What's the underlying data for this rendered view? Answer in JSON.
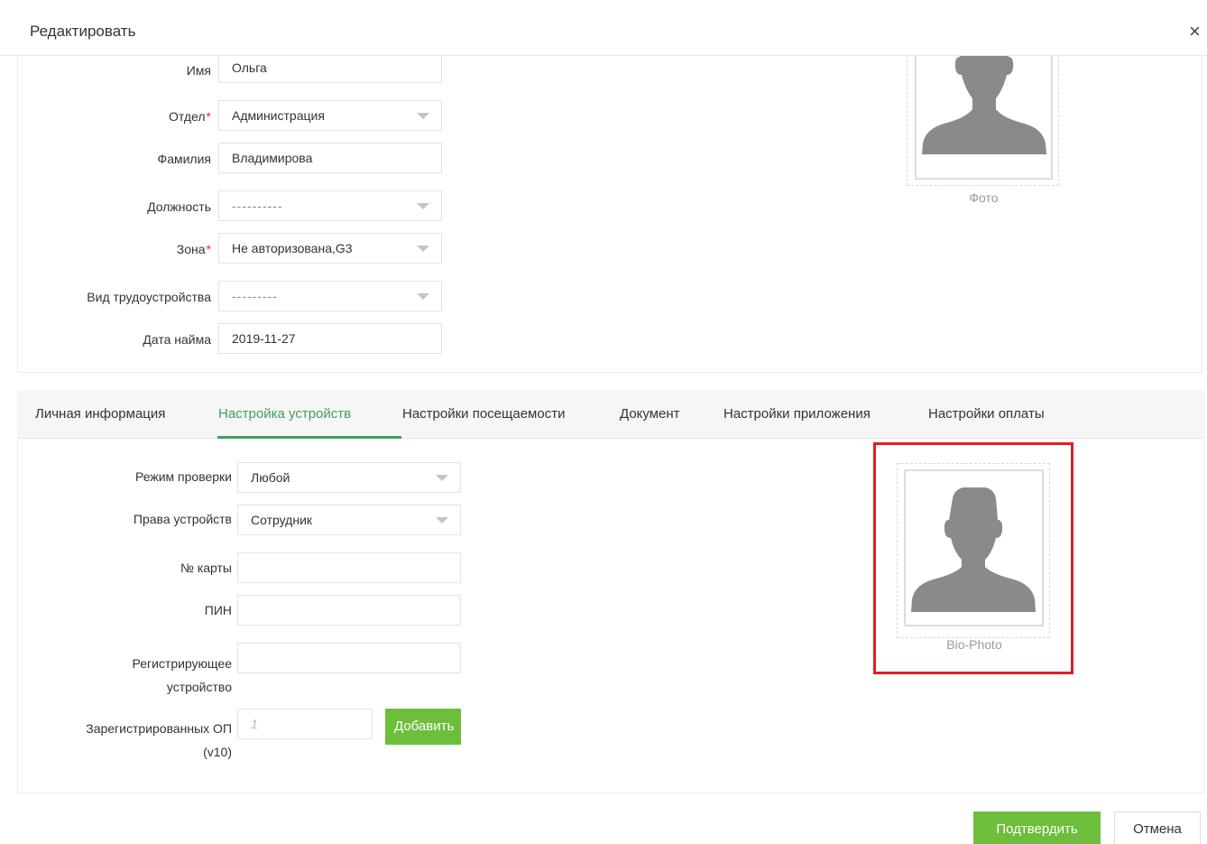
{
  "dialog": {
    "title": "Редактировать",
    "close": "×"
  },
  "top_form": {
    "first_name": {
      "label": "Имя",
      "value": "Ольга"
    },
    "department": {
      "label": "Отдел",
      "required": "*",
      "value": "Администрация"
    },
    "last_name": {
      "label": "Фамилия",
      "value": "Владимирова"
    },
    "position": {
      "label": "Должность",
      "value": "----------"
    },
    "zone": {
      "label": "Зона",
      "required": "*",
      "value": "Не авторизована,G3"
    },
    "employment_type": {
      "label": "Вид трудоустройства",
      "value": "---------"
    },
    "hire_date": {
      "label": "Дата найма",
      "value": "2019-11-27"
    },
    "photo_caption": "Фото"
  },
  "tabs": [
    {
      "label": "Личная информация",
      "active": false
    },
    {
      "label": "Настройка устройств",
      "active": true
    },
    {
      "label": "Настройки посещаемости",
      "active": false
    },
    {
      "label": "Документ",
      "active": false
    },
    {
      "label": "Настройки приложения",
      "active": false
    },
    {
      "label": "Настройки оплаты",
      "active": false
    }
  ],
  "device_settings": {
    "verify_mode": {
      "label": "Режим проверки",
      "value": "Любой"
    },
    "device_rights": {
      "label": "Права устройств",
      "value": "Сотрудник"
    },
    "card_no": {
      "label": "№ карты",
      "value": ""
    },
    "pin": {
      "label": "ПИН",
      "value": ""
    },
    "enroll_device": {
      "label_line1": "Регистрирующее",
      "label_line2": "устройство",
      "value": ""
    },
    "registered_fp": {
      "label_line1": "Зарегистрированных ОП",
      "label_line2": "(v10)",
      "placeholder": "1"
    },
    "add_button": "Добавить",
    "bio_photo_caption": "Bio-Photo"
  },
  "footer": {
    "confirm": "Подтвердить",
    "cancel": "Отмена"
  },
  "colors": {
    "accent_green": "#6dbe3a",
    "active_tab": "#3aa35c",
    "highlight_red": "#e01e26",
    "required_star": "#e0303a"
  },
  "icons": {
    "avatar": "person-silhouette-icon",
    "dropdown": "caret-down-icon",
    "close": "close-icon"
  }
}
